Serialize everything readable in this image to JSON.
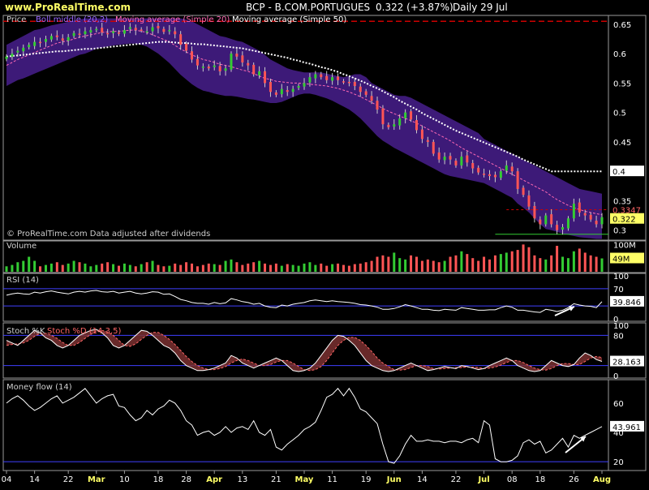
{
  "header": {
    "site": "www.ProRealTime.com",
    "ticker_line": "BCP - B.COM.PORTUGUES",
    "price_line": "0.322 (+3.87%)",
    "period_line": "Daily 29 Jul"
  },
  "colors": {
    "bg": "#000000",
    "panel_border": "#9a9a9a",
    "bollinger_band": "#3d1a78",
    "up": "#33cc33",
    "down": "#ff5555",
    "ma20": "#ff69b4",
    "ma50": "#ffffff",
    "volume_up": "#33cc33",
    "volume_down": "#ff5555",
    "line_primary": "#ffffff",
    "stoch_d": "#ff6666",
    "level_lines": "#3f3fff",
    "resistance": "#cc0000",
    "support": "#33cc33",
    "label_box": "#ffff66",
    "title_text": "#d0d0d0",
    "bollinger_label": "#9966ff",
    "ma20_label": "#ff69b4"
  },
  "chart_data": [
    {
      "type": "candlestick",
      "panel": "price",
      "legend": [
        "Price",
        "Boll middle (20,2)",
        "Moving average (Simple 20)",
        "Moving average (Simple 50)"
      ],
      "watermark": "© ProRealTime.com Data adjusted after dividends",
      "x_ticks": [
        "04",
        "14",
        "22",
        "Mar",
        "10",
        "18",
        "28",
        "Apr",
        "13",
        "21",
        "May",
        "11",
        "19",
        "Jun",
        "14",
        "22",
        "Jul",
        "08",
        "18",
        "26",
        "Aug"
      ],
      "y_ticks": [
        "0.65",
        "0.6",
        "0.55",
        "0.5",
        "0.45",
        "0.4",
        "0.35",
        "0.3"
      ],
      "y_ticks_values": [
        0.65,
        0.6,
        0.55,
        0.5,
        0.45,
        0.4,
        0.35,
        0.3
      ],
      "ylim": [
        0.283,
        0.665
      ],
      "lines": {
        "resistance": 0.655,
        "resistance2": 0.3347,
        "support": 0.293
      },
      "labels": {
        "ma50_last": "0.4",
        "res2_last": "0.3347",
        "last": "0.322"
      },
      "close": [
        0.595,
        0.6,
        0.605,
        0.61,
        0.615,
        0.62,
        0.618,
        0.625,
        0.63,
        0.628,
        0.622,
        0.628,
        0.635,
        0.632,
        0.638,
        0.64,
        0.642,
        0.636,
        0.634,
        0.638,
        0.634,
        0.64,
        0.645,
        0.64,
        0.64,
        0.638,
        0.645,
        0.643,
        0.637,
        0.64,
        0.633,
        0.615,
        0.605,
        0.59,
        0.58,
        0.578,
        0.575,
        0.58,
        0.57,
        0.575,
        0.6,
        0.595,
        0.585,
        0.58,
        0.565,
        0.57,
        0.55,
        0.535,
        0.53,
        0.54,
        0.535,
        0.54,
        0.545,
        0.55,
        0.56,
        0.565,
        0.56,
        0.555,
        0.56,
        0.555,
        0.552,
        0.55,
        0.545,
        0.535,
        0.53,
        0.52,
        0.505,
        0.48,
        0.475,
        0.48,
        0.49,
        0.5,
        0.488,
        0.47,
        0.455,
        0.45,
        0.43,
        0.42,
        0.425,
        0.42,
        0.41,
        0.425,
        0.415,
        0.405,
        0.398,
        0.395,
        0.392,
        0.39,
        0.4,
        0.41,
        0.4,
        0.37,
        0.36,
        0.34,
        0.32,
        0.31,
        0.325,
        0.31,
        0.3,
        0.305,
        0.32,
        0.345,
        0.33,
        0.325,
        0.318,
        0.31,
        0.322
      ],
      "ma20": [
        0.58,
        0.585,
        0.59,
        0.594,
        0.598,
        0.602,
        0.606,
        0.61,
        0.614,
        0.618,
        0.62,
        0.622,
        0.625,
        0.628,
        0.63,
        0.632,
        0.634,
        0.636,
        0.637,
        0.638,
        0.638,
        0.639,
        0.64,
        0.64,
        0.638,
        0.636,
        0.632,
        0.628,
        0.624,
        0.62,
        0.614,
        0.608,
        0.603,
        0.598,
        0.594,
        0.59,
        0.588,
        0.585,
        0.582,
        0.58,
        0.578,
        0.575,
        0.572,
        0.57,
        0.566,
        0.562,
        0.558,
        0.556,
        0.553,
        0.552,
        0.551,
        0.55,
        0.55,
        0.549,
        0.548,
        0.547,
        0.546,
        0.545,
        0.543,
        0.541,
        0.538,
        0.535,
        0.531,
        0.527,
        0.522,
        0.517,
        0.512,
        0.507,
        0.502,
        0.498,
        0.494,
        0.49,
        0.486,
        0.482,
        0.477,
        0.472,
        0.467,
        0.462,
        0.457,
        0.452,
        0.446,
        0.44,
        0.435,
        0.43,
        0.425,
        0.42,
        0.415,
        0.41,
        0.405,
        0.4,
        0.395,
        0.39,
        0.385,
        0.38,
        0.375,
        0.37,
        0.365,
        0.358,
        0.352,
        0.347,
        0.342,
        0.338,
        0.335,
        0.332,
        0.33,
        0.328,
        0.326
      ],
      "ma50": [
        0.595,
        0.596,
        0.597,
        0.598,
        0.599,
        0.6,
        0.601,
        0.602,
        0.603,
        0.604,
        0.604,
        0.605,
        0.606,
        0.607,
        0.608,
        0.608,
        0.609,
        0.61,
        0.611,
        0.612,
        0.613,
        0.614,
        0.615,
        0.616,
        0.617,
        0.618,
        0.619,
        0.62,
        0.62,
        0.62,
        0.619,
        0.618,
        0.618,
        0.617,
        0.616,
        0.616,
        0.615,
        0.614,
        0.613,
        0.612,
        0.611,
        0.61,
        0.609,
        0.607,
        0.605,
        0.603,
        0.601,
        0.599,
        0.597,
        0.595,
        0.593,
        0.59,
        0.588,
        0.585,
        0.583,
        0.58,
        0.577,
        0.575,
        0.572,
        0.569,
        0.565,
        0.562,
        0.558,
        0.554,
        0.55,
        0.545,
        0.541,
        0.536,
        0.531,
        0.526,
        0.52,
        0.515,
        0.51,
        0.505,
        0.499,
        0.494,
        0.489,
        0.484,
        0.479,
        0.474,
        0.469,
        0.465,
        0.461,
        0.457,
        0.453,
        0.449,
        0.445,
        0.441,
        0.437,
        0.433,
        0.429,
        0.425,
        0.42,
        0.416,
        0.412,
        0.408,
        0.404,
        0.4,
        0.4,
        0.4,
        0.4,
        0.4,
        0.4,
        0.4,
        0.4,
        0.4,
        0.4
      ],
      "boll_upper": [
        0.615,
        0.62,
        0.625,
        0.63,
        0.635,
        0.64,
        0.642,
        0.645,
        0.648,
        0.65,
        0.652,
        0.654,
        0.656,
        0.658,
        0.66,
        0.66,
        0.66,
        0.66,
        0.66,
        0.66,
        0.66,
        0.66,
        0.66,
        0.66,
        0.66,
        0.66,
        0.66,
        0.66,
        0.66,
        0.66,
        0.66,
        0.66,
        0.658,
        0.655,
        0.65,
        0.645,
        0.64,
        0.635,
        0.63,
        0.628,
        0.625,
        0.622,
        0.62,
        0.615,
        0.61,
        0.605,
        0.598,
        0.59,
        0.585,
        0.58,
        0.575,
        0.572,
        0.57,
        0.568,
        0.568,
        0.568,
        0.568,
        0.566,
        0.564,
        0.562,
        0.56,
        0.562,
        0.565,
        0.565,
        0.56,
        0.55,
        0.545,
        0.54,
        0.535,
        0.53,
        0.528,
        0.528,
        0.525,
        0.52,
        0.515,
        0.51,
        0.505,
        0.5,
        0.495,
        0.49,
        0.485,
        0.48,
        0.475,
        0.47,
        0.465,
        0.455,
        0.45,
        0.445,
        0.44,
        0.435,
        0.43,
        0.425,
        0.42,
        0.415,
        0.41,
        0.405,
        0.4,
        0.395,
        0.39,
        0.385,
        0.38,
        0.375,
        0.37,
        0.368,
        0.366,
        0.364,
        0.362
      ],
      "boll_lower": [
        0.545,
        0.55,
        0.555,
        0.558,
        0.562,
        0.566,
        0.57,
        0.574,
        0.578,
        0.582,
        0.586,
        0.59,
        0.594,
        0.598,
        0.6,
        0.604,
        0.608,
        0.61,
        0.612,
        0.614,
        0.615,
        0.616,
        0.617,
        0.617,
        0.615,
        0.612,
        0.606,
        0.6,
        0.592,
        0.584,
        0.574,
        0.564,
        0.556,
        0.548,
        0.542,
        0.537,
        0.535,
        0.532,
        0.53,
        0.528,
        0.528,
        0.527,
        0.525,
        0.523,
        0.522,
        0.52,
        0.518,
        0.516,
        0.516,
        0.518,
        0.522,
        0.526,
        0.53,
        0.532,
        0.532,
        0.53,
        0.527,
        0.524,
        0.52,
        0.515,
        0.51,
        0.505,
        0.498,
        0.49,
        0.48,
        0.47,
        0.46,
        0.452,
        0.446,
        0.44,
        0.435,
        0.43,
        0.425,
        0.42,
        0.415,
        0.41,
        0.405,
        0.4,
        0.395,
        0.392,
        0.39,
        0.388,
        0.386,
        0.384,
        0.382,
        0.38,
        0.375,
        0.37,
        0.365,
        0.36,
        0.355,
        0.345,
        0.338,
        0.33,
        0.32,
        0.31,
        0.302,
        0.3,
        0.297,
        0.294,
        0.292,
        0.29,
        0.288,
        0.287,
        0.286,
        0.285,
        0.285
      ]
    },
    {
      "type": "bar",
      "panel": "volume",
      "title": "Volume",
      "y_ticks": [
        "100M"
      ],
      "y_ticks_values": [
        100
      ],
      "ylim": [
        0,
        110
      ],
      "last_label": "49M",
      "last_value": 49,
      "values": [
        20,
        25,
        35,
        40,
        55,
        40,
        20,
        25,
        30,
        35,
        25,
        30,
        40,
        35,
        30,
        20,
        25,
        30,
        35,
        28,
        22,
        30,
        25,
        20,
        28,
        35,
        40,
        25,
        20,
        22,
        30,
        25,
        35,
        30,
        20,
        25,
        30,
        28,
        25,
        40,
        45,
        35,
        25,
        30,
        35,
        40,
        30,
        25,
        30,
        22,
        28,
        25,
        22,
        30,
        35,
        25,
        30,
        22,
        28,
        30,
        25,
        22,
        28,
        30,
        35,
        40,
        55,
        60,
        55,
        70,
        50,
        45,
        60,
        55,
        40,
        45,
        40,
        35,
        40,
        55,
        60,
        75,
        65,
        50,
        40,
        55,
        45,
        60,
        65,
        70,
        75,
        80,
        100,
        90,
        60,
        50,
        45,
        60,
        95,
        55,
        50,
        75,
        85,
        70,
        60,
        55,
        49
      ]
    },
    {
      "type": "line",
      "panel": "rsi",
      "title": "RSI (14)",
      "y_ticks": [
        "100",
        "70",
        "0"
      ],
      "y_ticks_values": [
        100,
        70,
        0
      ],
      "ylim": [
        0,
        100
      ],
      "levels": [
        70,
        30
      ],
      "last_label": "39.846",
      "annotation_arrow": true,
      "values": [
        55,
        58,
        60,
        58,
        57,
        62,
        60,
        63,
        65,
        62,
        60,
        58,
        62,
        64,
        62,
        65,
        66,
        63,
        62,
        64,
        60,
        62,
        64,
        60,
        58,
        60,
        63,
        62,
        57,
        58,
        52,
        45,
        42,
        38,
        36,
        36,
        34,
        38,
        35,
        37,
        47,
        44,
        40,
        38,
        34,
        36,
        30,
        27,
        26,
        32,
        30,
        34,
        36,
        38,
        42,
        44,
        42,
        40,
        42,
        40,
        39,
        38,
        36,
        33,
        32,
        30,
        27,
        22,
        22,
        24,
        28,
        33,
        30,
        26,
        22,
        22,
        20,
        19,
        22,
        21,
        20,
        26,
        24,
        22,
        20,
        20,
        21,
        21,
        26,
        30,
        27,
        20,
        20,
        18,
        16,
        15,
        22,
        20,
        17,
        20,
        26,
        35,
        32,
        30,
        29,
        26,
        39.8
      ]
    },
    {
      "type": "line",
      "panel": "stoch",
      "title": "Stoch %K",
      "subtitle": "Stoch %D (14,3,5)",
      "y_ticks": [
        "100",
        "80",
        "0"
      ],
      "y_ticks_values": [
        100,
        80,
        0
      ],
      "ylim": [
        0,
        100
      ],
      "levels": [
        80,
        20
      ],
      "last_label": "28.163",
      "k": [
        70,
        65,
        60,
        70,
        80,
        90,
        85,
        75,
        70,
        60,
        55,
        60,
        70,
        80,
        85,
        90,
        92,
        85,
        75,
        60,
        55,
        60,
        70,
        80,
        90,
        88,
        80,
        70,
        60,
        55,
        45,
        30,
        20,
        15,
        10,
        10,
        12,
        15,
        20,
        25,
        40,
        35,
        25,
        20,
        15,
        20,
        25,
        30,
        35,
        30,
        20,
        10,
        8,
        10,
        15,
        25,
        40,
        55,
        70,
        80,
        78,
        70,
        60,
        45,
        30,
        20,
        15,
        10,
        8,
        10,
        15,
        20,
        25,
        20,
        15,
        10,
        12,
        15,
        18,
        16,
        14,
        20,
        18,
        15,
        12,
        14,
        20,
        25,
        30,
        35,
        30,
        20,
        15,
        10,
        8,
        10,
        20,
        30,
        25,
        20,
        18,
        22,
        35,
        45,
        40,
        32,
        28.2
      ],
      "d": [
        60,
        62,
        63,
        65,
        70,
        78,
        84,
        84,
        80,
        74,
        66,
        60,
        60,
        66,
        74,
        82,
        88,
        90,
        87,
        80,
        70,
        60,
        58,
        63,
        72,
        80,
        86,
        86,
        80,
        72,
        62,
        50,
        38,
        28,
        20,
        15,
        12,
        12,
        14,
        18,
        25,
        30,
        33,
        30,
        25,
        20,
        20,
        22,
        27,
        30,
        30,
        25,
        18,
        12,
        10,
        12,
        18,
        30,
        45,
        60,
        70,
        76,
        76,
        70,
        60,
        48,
        35,
        25,
        18,
        12,
        11,
        12,
        16,
        20,
        20,
        18,
        14,
        13,
        14,
        15,
        16,
        16,
        17,
        17,
        16,
        14,
        15,
        17,
        21,
        26,
        30,
        30,
        26,
        20,
        15,
        12,
        11,
        14,
        20,
        24,
        24,
        22,
        22,
        28,
        35,
        38,
        36
      ]
    },
    {
      "type": "line",
      "panel": "moneyflow",
      "title": "Money flow (14)",
      "y_ticks": [
        "60",
        "40",
        "20"
      ],
      "y_ticks_values": [
        60,
        40,
        20
      ],
      "ylim": [
        14,
        76
      ],
      "levels": [
        20
      ],
      "last_label": "43.961",
      "annotation_arrow": true,
      "values": [
        60,
        63,
        65,
        62,
        58,
        55,
        57,
        60,
        63,
        65,
        60,
        62,
        64,
        67,
        70,
        65,
        60,
        63,
        65,
        66,
        58,
        57,
        52,
        48,
        50,
        55,
        52,
        56,
        58,
        62,
        60,
        55,
        48,
        45,
        38,
        40,
        41,
        38,
        40,
        44,
        40,
        43,
        44,
        42,
        48,
        40,
        38,
        42,
        30,
        28,
        32,
        35,
        38,
        42,
        44,
        47,
        55,
        64,
        66,
        70,
        65,
        70,
        64,
        56,
        54,
        50,
        46,
        32,
        20,
        19,
        24,
        32,
        38,
        34,
        34,
        35,
        34,
        34,
        33,
        34,
        34,
        33,
        35,
        36,
        33,
        48,
        45,
        22,
        20,
        20,
        21,
        24,
        33,
        35,
        32,
        34,
        26,
        28,
        32,
        36,
        30,
        38,
        36,
        38,
        40,
        42,
        44
      ]
    }
  ]
}
